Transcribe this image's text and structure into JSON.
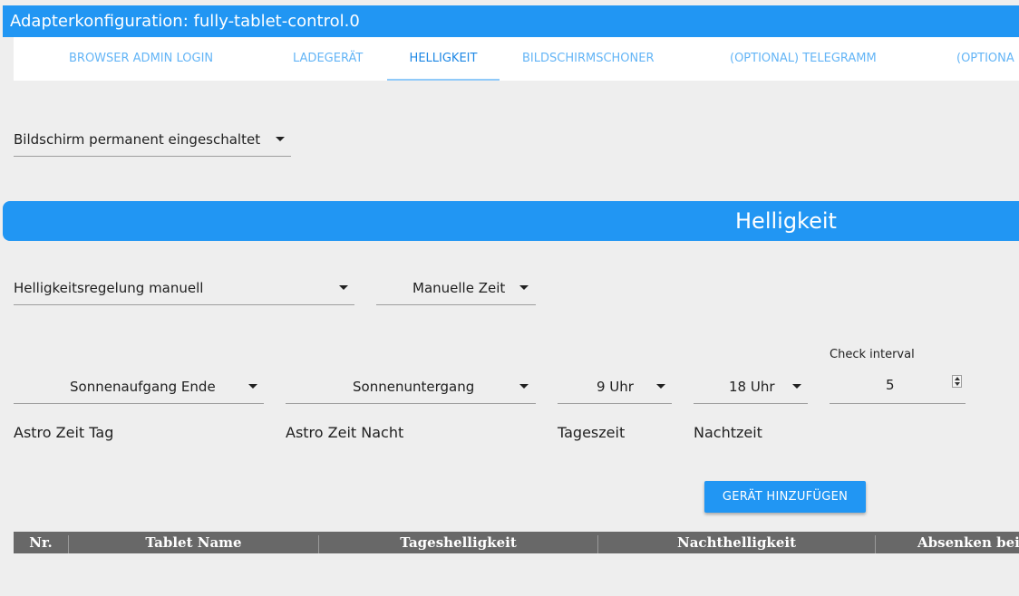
{
  "window": {
    "title": "Adapterkonfiguration: fully-tablet-control.0"
  },
  "tabs": [
    {
      "label": "BROWSER ADMIN LOGIN",
      "active": false
    },
    {
      "label": "LADEGERÄT",
      "active": false
    },
    {
      "label": "HELLIGKEIT",
      "active": true
    },
    {
      "label": "BILDSCHIRMSCHONER",
      "active": false
    },
    {
      "label": "(OPTIONAL) TELEGRAMM",
      "active": false
    },
    {
      "label": "(OPTIONA",
      "active": false
    }
  ],
  "screen_mode": {
    "value": "Bildschirm permanent eingeschaltet"
  },
  "section": {
    "title": "Helligkeit"
  },
  "brightness_control": {
    "value": "Helligkeitsregelung manuell"
  },
  "time_mode": {
    "value": "Manuelle Zeit"
  },
  "astro_day": {
    "value": "Sonnenaufgang Ende",
    "label": "Astro Zeit Tag"
  },
  "astro_night": {
    "value": "Sonnenuntergang",
    "label": "Astro Zeit Nacht"
  },
  "day_time": {
    "value": "9 Uhr",
    "label": "Tageszeit"
  },
  "night_time": {
    "value": "18 Uhr",
    "label": "Nachtzeit"
  },
  "check_interval": {
    "label": "Check interval",
    "value": "5"
  },
  "add_device_button": {
    "label": "GERÄT HINZUFÜGEN"
  },
  "table": {
    "columns": [
      "Nr.",
      "Tablet Name",
      "Tageshelligkeit",
      "Nachthelligkeit",
      "Absenken bei"
    ]
  },
  "colors": {
    "accent": "#2196f3",
    "tab_text": "#64b5f6",
    "table_header": "#686868",
    "background": "#eeeeee"
  },
  "icons": {
    "select_caret": "caret-down-icon",
    "spinner": "number-spinner-icon"
  }
}
